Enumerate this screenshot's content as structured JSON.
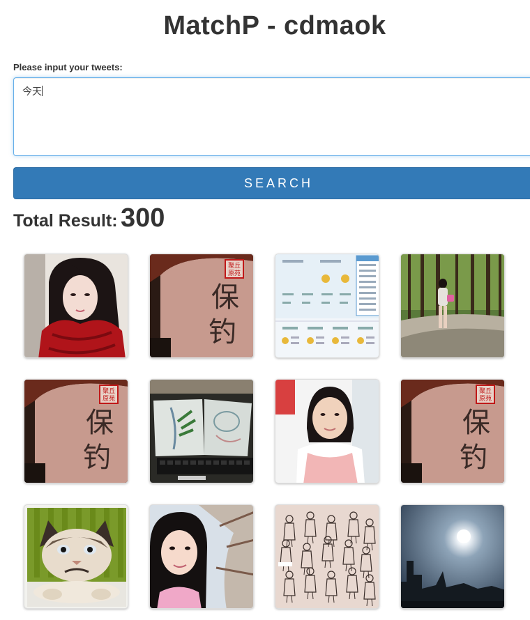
{
  "header": {
    "title": "MatchP - cdmaok"
  },
  "form": {
    "label": "Please input your tweets:",
    "tweet_value": "今天",
    "search_label": "SEARCH"
  },
  "results": {
    "total_label": "Total Result:",
    "total_value": "300",
    "images": [
      {
        "name": "girl-red-scarf-photo",
        "kind": "girl-scarf"
      },
      {
        "name": "shirt-calligraphy-photo",
        "kind": "shirt",
        "text": "保钓",
        "stamp": "聚丘原苑"
      },
      {
        "name": "app-screenshot-thumbnail",
        "kind": "screenshot"
      },
      {
        "name": "girl-walking-forest-photo",
        "kind": "forest"
      },
      {
        "name": "shirt-calligraphy-photo",
        "kind": "shirt",
        "text": "保钓",
        "stamp": "聚丘原苑"
      },
      {
        "name": "drawings-on-desk-photo",
        "kind": "drawings"
      },
      {
        "name": "girl-pink-dress-photo",
        "kind": "girl-pink"
      },
      {
        "name": "shirt-calligraphy-photo",
        "kind": "shirt",
        "text": "保钓",
        "stamp": "聚丘原苑"
      },
      {
        "name": "grumpy-cat-photo",
        "kind": "cat"
      },
      {
        "name": "girl-selfie-photo",
        "kind": "selfie"
      },
      {
        "name": "fashion-sketches-photo",
        "kind": "sketches"
      },
      {
        "name": "sun-sky-photo",
        "kind": "sun"
      }
    ]
  }
}
